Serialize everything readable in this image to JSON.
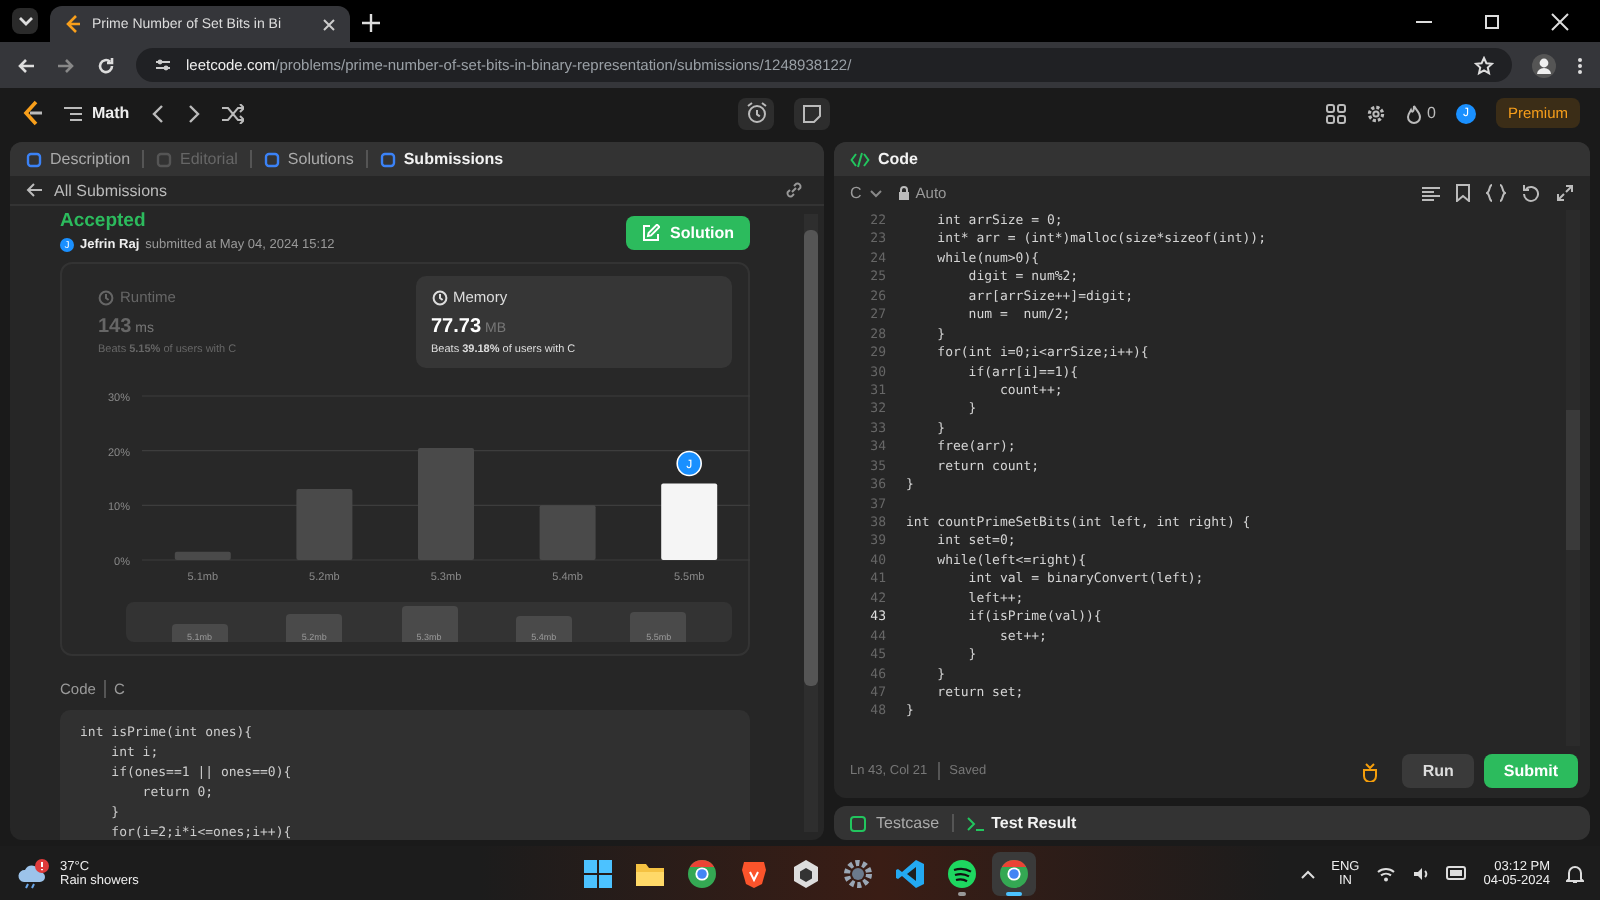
{
  "browser": {
    "tab_title": "Prime Number of Set Bits in Bi",
    "url_host": "leetcode.com",
    "url_path": "/problems/prime-number-of-set-bits-in-binary-representation/submissions/1248938122/"
  },
  "nav": {
    "topic": "Math",
    "streak": "0",
    "avatar": "J",
    "premium": "Premium"
  },
  "left_tabs": [
    {
      "label": "Description",
      "selected": false,
      "disabled": false
    },
    {
      "label": "Editorial",
      "selected": false,
      "disabled": true
    },
    {
      "label": "Solutions",
      "selected": false,
      "disabled": false
    },
    {
      "label": "Submissions",
      "selected": true,
      "disabled": false
    }
  ],
  "submission": {
    "back": "All Submissions",
    "status": "Accepted",
    "avatar": "J",
    "user": "Jefrin Raj",
    "submitted": "submitted at May 04, 2024 15:12",
    "solution_button": "Solution",
    "stats": [
      {
        "label": "Runtime",
        "value": "143",
        "unit": "ms",
        "beats": "Beats **5.15%** of users with C",
        "selected": false
      },
      {
        "label": "Memory",
        "value": "77.73",
        "unit": "MB",
        "beats": "Beats **39.18%** of users with C",
        "selected": true
      }
    ],
    "chart_data": {
      "type": "bar",
      "categories": [
        "5.1mb",
        "5.2mb",
        "5.3mb",
        "5.4mb",
        "5.5mb"
      ],
      "values": [
        1.5,
        13,
        20.5,
        10,
        14
      ],
      "ylim": [
        0,
        30
      ],
      "yticks": [
        {
          "value": 0,
          "label": "0%"
        },
        {
          "value": 10,
          "label": "10%"
        },
        {
          "value": 20,
          "label": "20%"
        },
        {
          "value": 30,
          "label": "30%"
        }
      ],
      "annotations": [
        {
          "x": "5.5mb",
          "y": 14,
          "text": "J"
        }
      ]
    },
    "range_labels": [
      "5.1mb",
      "5.2mb",
      "5.3mb",
      "5.4mb",
      "5.5mb"
    ],
    "code_label": "Code",
    "code_lang": "C",
    "code_lines": [
      "int isPrime(int ones){",
      "    int i;",
      "    if(ones==1 || ones==0){",
      "        return 0;",
      "    }",
      "    for(i=2;i*i<=ones;i++){"
    ]
  },
  "editor": {
    "tab": "Code",
    "language": "C",
    "mode": "Auto",
    "lines": [
      {
        "n": "22",
        "text": "    int arrSize = 0;",
        "current": false
      },
      {
        "n": "23",
        "text": "    int* arr = (int*)malloc(size*sizeof(int));",
        "current": false
      },
      {
        "n": "24",
        "text": "    while(num>0){",
        "current": false
      },
      {
        "n": "25",
        "text": "        digit = num%2;",
        "current": false
      },
      {
        "n": "26",
        "text": "        arr[arrSize++]=digit;",
        "current": false
      },
      {
        "n": "27",
        "text": "        num =  num/2;",
        "current": false
      },
      {
        "n": "28",
        "text": "    }",
        "current": false
      },
      {
        "n": "29",
        "text": "    for(int i=0;i<arrSize;i++){",
        "current": false
      },
      {
        "n": "30",
        "text": "        if(arr[i]==1){",
        "current": false
      },
      {
        "n": "31",
        "text": "            count++;",
        "current": false
      },
      {
        "n": "32",
        "text": "        }",
        "current": false
      },
      {
        "n": "33",
        "text": "    }",
        "current": false
      },
      {
        "n": "34",
        "text": "    free(arr);",
        "current": false
      },
      {
        "n": "35",
        "text": "    return count;",
        "current": false
      },
      {
        "n": "36",
        "text": "}",
        "current": false
      },
      {
        "n": "37",
        "current": false
      },
      {
        "n": "38",
        "text": "int countPrimeSetBits(int left, int right) {",
        "current": false
      },
      {
        "n": "39",
        "text": "    int set=0;",
        "current": false
      },
      {
        "n": "40",
        "text": "    while(left<=right){",
        "current": false
      },
      {
        "n": "41",
        "text": "        int val = binaryConvert(left);",
        "current": false
      },
      {
        "n": "42",
        "text": "        left++;",
        "current": false
      },
      {
        "n": "43",
        "text": "        if(isPrime(val)){",
        "current": true
      },
      {
        "n": "44",
        "text": "            set++;",
        "current": false
      },
      {
        "n": "45",
        "text": "        }",
        "current": false
      },
      {
        "n": "46",
        "text": "    }",
        "current": false
      },
      {
        "n": "47",
        "text": "    return set;",
        "current": false
      },
      {
        "n": "48",
        "text": "}",
        "current": false
      }
    ],
    "position": "Ln 43, Col 21",
    "saved": "Saved",
    "run": "Run",
    "submit": "Submit"
  },
  "bottom_tabs": [
    {
      "label": "Testcase",
      "selected": false
    },
    {
      "label": "Test Result",
      "selected": true
    }
  ],
  "taskbar": {
    "temperature": "37°C",
    "weather": "Rain showers",
    "apps": [
      {
        "kind": "windows",
        "running": false,
        "active": false
      },
      {
        "kind": "folder",
        "running": false,
        "active": false
      },
      {
        "kind": "chrome",
        "running": false,
        "active": false
      },
      {
        "kind": "brave",
        "running": false,
        "active": false
      },
      {
        "kind": "cube",
        "running": false,
        "active": false
      },
      {
        "kind": "gear",
        "running": false,
        "active": false
      },
      {
        "kind": "vscode",
        "running": false,
        "active": false
      },
      {
        "kind": "spotify",
        "running": true,
        "active": false
      },
      {
        "kind": "chrome",
        "running": true,
        "active": true
      }
    ],
    "language": "ENG",
    "region": "IN",
    "time": "03:12 PM",
    "date": "04-05-2024"
  }
}
